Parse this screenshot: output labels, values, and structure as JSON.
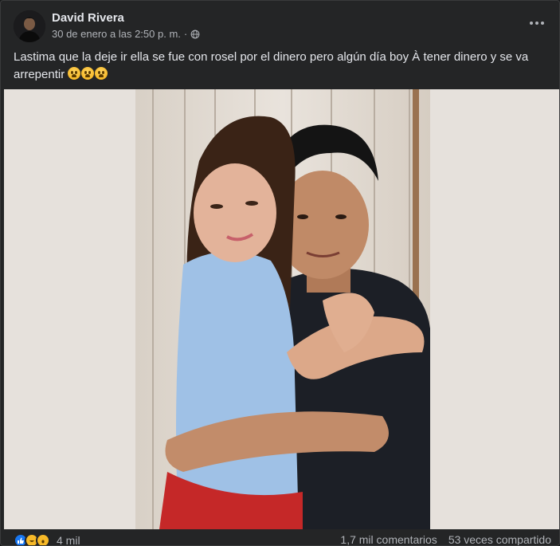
{
  "post": {
    "author": "David Rivera",
    "timestamp": "30 de enero a las 2:50 p. m.",
    "separator": "·",
    "privacy_icon": "globe-icon",
    "text_main": "Lastima que la deje ir ella se fue con rosel por el dinero pero algún día boy À tener dinero y se va arrepentir",
    "text_emojis": [
      "crying-face-emoji",
      "crying-face-emoji",
      "crying-face-emoji"
    ],
    "more_icon": "more-options-icon"
  },
  "footer": {
    "reactions": [
      "like-reaction",
      "haha-reaction",
      "wow-reaction"
    ],
    "reaction_count": "4 mil",
    "comments": "1,7 mil comentarios",
    "shares": "53 veces compartido"
  },
  "colors": {
    "background": "#242526",
    "text": "#e4e6eb",
    "secondary_text": "#b0b3b8",
    "like_blue": "#1877f2"
  }
}
